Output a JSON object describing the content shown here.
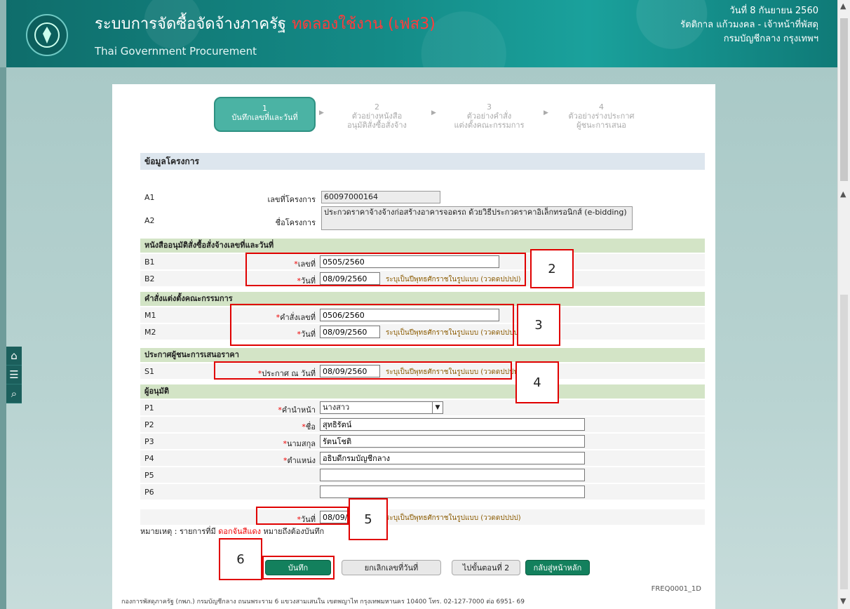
{
  "header": {
    "title": "ระบบการจัดซื้อจัดจ้างภาครัฐ",
    "trial": "ทดลองใช้งาน (เฟส3)",
    "subtitle": "Thai Government Procurement",
    "date": "วันที่ 8 กันยายน 2560",
    "user": "รัตติกาล แก้วมงคล - เจ้าหน้าที่พัสดุ",
    "dept": "กรมบัญชีกลาง กรุงเทพฯ"
  },
  "steps": [
    {
      "num": "1",
      "line1": "บันทึกเลขที่และวันที่",
      "line2": ""
    },
    {
      "num": "2",
      "line1": "ตัวอย่างหนังสือ",
      "line2": "อนุมัติสั่งซื้อสั่งจ้าง"
    },
    {
      "num": "3",
      "line1": "ตัวอย่างคำสั่ง",
      "line2": "แต่งตั้งคณะกรรมการ"
    },
    {
      "num": "4",
      "line1": "ตัวอย่างร่างประกาศ",
      "line2": "ผู้ชนะการเสนอ"
    }
  ],
  "project": {
    "heading": "ข้อมูลโครงการ",
    "a1_code": "A1",
    "a1_label": "เลขที่โครงการ",
    "a1_value": "60097000164",
    "a2_code": "A2",
    "a2_label": "ชื่อโครงการ",
    "a2_value": "ประกวดราคาจ้างจ้างก่อสร้างอาคารจอดรถ ด้วยวิธีประกวดราคาอิเล็กทรอนิกส์ (e-bidding)"
  },
  "approval": {
    "heading": "หนังสืออนุมัติสั่งซื้อสั่งจ้างเลขที่และวันที่",
    "b1_code": "B1",
    "b1_label": "เลขที่",
    "b1_value": "0505/2560",
    "b2_code": "B2",
    "b2_label": "วันที่",
    "b2_value": "08/09/2560"
  },
  "order": {
    "heading": "คำสั่งแต่งตั้งคณะกรรมการ",
    "m1_code": "M1",
    "m1_label": "คำสั่งเลขที่",
    "m1_value": "0506/2560",
    "m2_code": "M2",
    "m2_label": "วันที่",
    "m2_value": "08/09/2560"
  },
  "announce": {
    "heading": "ประกาศผู้ชนะการเสนอราคา",
    "s1_code": "S1",
    "s1_label": "ประกาศ ณ วันที่",
    "s1_value": "08/09/2560"
  },
  "approver": {
    "heading": "ผู้อนุมัติ",
    "p1_code": "P1",
    "p1_label": "คำนำหน้า",
    "p1_value": "นางสาว",
    "p2_code": "P2",
    "p2_label": "ชื่อ",
    "p2_value": "สุทธิรัตน์",
    "p3_code": "P3",
    "p3_label": "นามสกุล",
    "p3_value": "รัตนโชติ",
    "p4_code": "P4",
    "p4_label": "ตำแหน่ง",
    "p4_value": "อธิบดีกรมบัญชีกลาง",
    "p5_code": "P5",
    "p5_value": "",
    "p6_code": "P6",
    "p6_value": "",
    "date_label": "วันที่",
    "date_value": "08/09/2560"
  },
  "hint": "ระบุเป็นปีพุทธศักราชในรูปแบบ (ววดดปปปป)",
  "req_mark": "*",
  "note": {
    "prefix": "หมายเหตุ : รายการที่มี",
    "red": "ดอกจันสีแดง",
    "suffix": "หมายถึงต้องบันทึก"
  },
  "buttons": {
    "save": "บันทึก",
    "cancel": "ยกเลิกเลขที่วันที่",
    "next": "ไปขั้นตอนที่ 2",
    "home": "กลับสู่หน้าหลัก"
  },
  "footer": "กองการพัสดุภาครัฐ (กพภ.) กรมบัญชีกลาง ถนนพระราม 6 แขวงสามเสนใน เขตพญาไท กรุงเทพมหานคร 10400 โทร. 02-127-7000 ต่อ 6951- 69",
  "screen_code": "FREQ0001_1D",
  "callouts": [
    "2",
    "3",
    "4",
    "5",
    "6"
  ],
  "icons": {
    "home": "home-icon",
    "menu": "menu-icon",
    "search": "search-icon"
  }
}
